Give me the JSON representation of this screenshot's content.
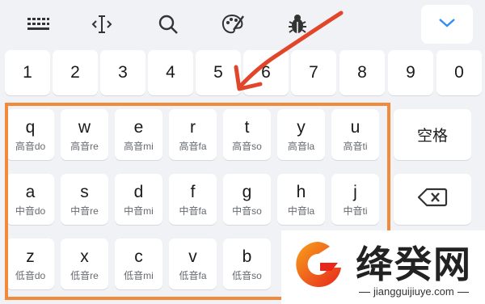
{
  "toolbar": {
    "icons": [
      "keyboard-icon",
      "text-cursor-icon",
      "search-icon",
      "palette-icon",
      "bug-icon",
      "chevron-down-icon"
    ]
  },
  "number_row": [
    "1",
    "2",
    "3",
    "4",
    "5",
    "6",
    "7",
    "8",
    "9",
    "0"
  ],
  "letter_rows": [
    [
      {
        "key": "q",
        "note": "高音do"
      },
      {
        "key": "w",
        "note": "高音re"
      },
      {
        "key": "e",
        "note": "高音mi"
      },
      {
        "key": "r",
        "note": "高音fa"
      },
      {
        "key": "t",
        "note": "高音so"
      },
      {
        "key": "y",
        "note": "高音la"
      },
      {
        "key": "u",
        "note": "高音ti"
      }
    ],
    [
      {
        "key": "a",
        "note": "中音do"
      },
      {
        "key": "s",
        "note": "中音re"
      },
      {
        "key": "d",
        "note": "中音mi"
      },
      {
        "key": "f",
        "note": "中音fa"
      },
      {
        "key": "g",
        "note": "中音so"
      },
      {
        "key": "h",
        "note": "中音la"
      },
      {
        "key": "j",
        "note": "中音ti"
      }
    ],
    [
      {
        "key": "z",
        "note": "低音do"
      },
      {
        "key": "x",
        "note": "低音re"
      },
      {
        "key": "c",
        "note": "低音mi"
      },
      {
        "key": "v",
        "note": "低音fa"
      },
      {
        "key": "b",
        "note": "低音so"
      }
    ]
  ],
  "side_keys": {
    "space_label": "空格",
    "delete_icon": "backspace-icon"
  },
  "watermark": {
    "title": "绛癸网",
    "url": "jiangguijiuye.com"
  },
  "colors": {
    "highlight": "#f28a3c",
    "arrow": "#e2462a",
    "collapse_icon": "#2f8ff5"
  }
}
